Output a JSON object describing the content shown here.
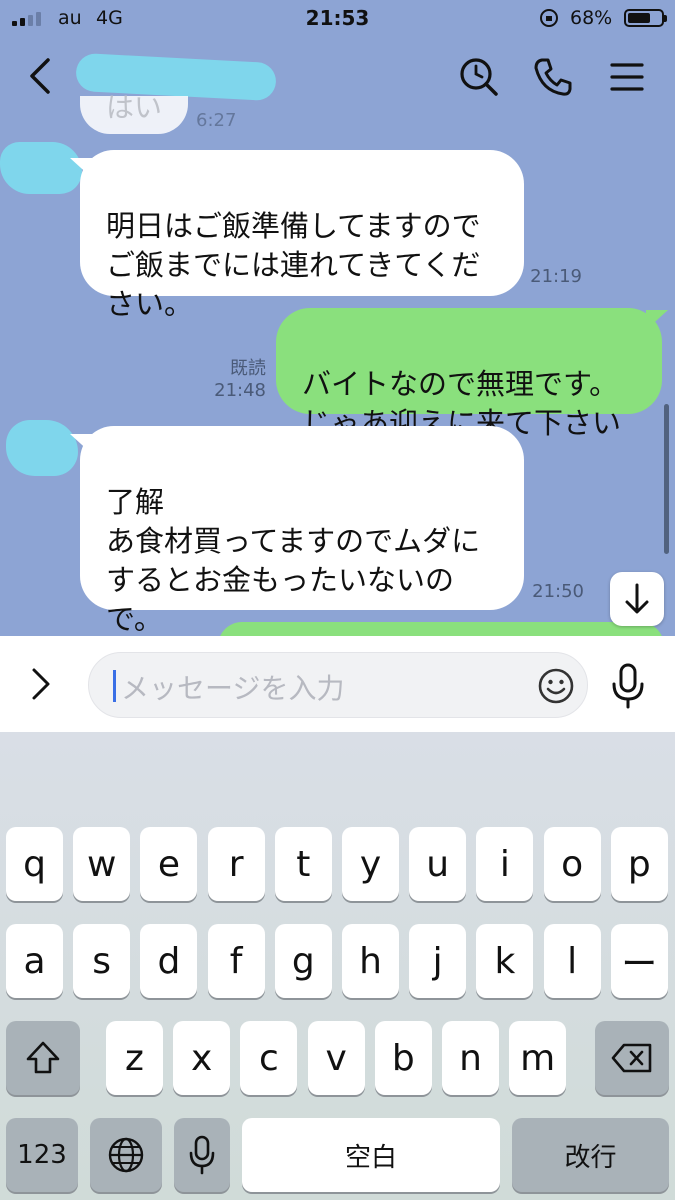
{
  "status_bar": {
    "carrier": "au",
    "network": "4G",
    "time": "21:53",
    "battery_pct": "68%",
    "battery_level": 0.68
  },
  "chat": {
    "partial_message": {
      "text": "はい",
      "time": "6:27"
    },
    "messages": [
      {
        "side": "left",
        "text": "明日はご飯準備してますので\nご飯までには連れてきてくだ\nさい。",
        "time": "21:19"
      },
      {
        "side": "right",
        "text": "バイトなので無理です。\nじゃあ迎えに来て下さい",
        "read_label": "既読",
        "time": "21:48"
      },
      {
        "side": "left",
        "text": "了解\nあ食材買ってますのでムダに\nするとお金もったいないの\nで。",
        "time": "21:50"
      }
    ]
  },
  "input": {
    "placeholder": "メッセージを入力"
  },
  "keyboard": {
    "row1": [
      "q",
      "w",
      "e",
      "r",
      "t",
      "y",
      "u",
      "i",
      "o",
      "p"
    ],
    "row2": [
      "a",
      "s",
      "d",
      "f",
      "g",
      "h",
      "j",
      "k",
      "l",
      "ー"
    ],
    "row3": [
      "z",
      "x",
      "c",
      "v",
      "b",
      "n",
      "m"
    ],
    "numbers_label": "123",
    "space_label": "空白",
    "return_label": "改行"
  },
  "icons": [
    "back-icon",
    "search-history-icon",
    "phone-icon",
    "menu-icon",
    "chevron-right-icon",
    "emoji-icon",
    "microphone-icon",
    "arrow-down-icon",
    "shift-icon",
    "delete-icon",
    "globe-icon"
  ]
}
